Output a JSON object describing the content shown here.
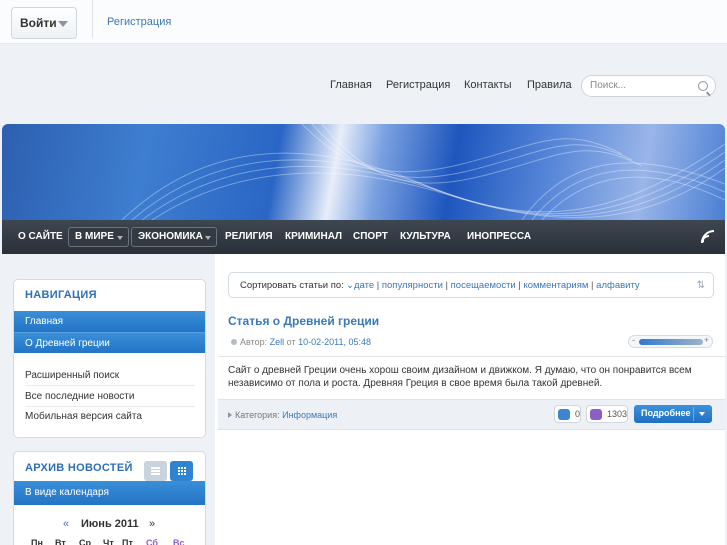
{
  "topbar": {
    "login_label": "Войти",
    "register_link": "Регистрация"
  },
  "header": {
    "menu": [
      "Главная",
      "Регистрация",
      "Контакты",
      "Правила"
    ],
    "search_placeholder": "Поиск..."
  },
  "mainnav": {
    "items": [
      "О САЙТЕ",
      "В МИРЕ",
      "ЭКОНОМИКА",
      "РЕЛИГИЯ",
      "КРИМИНАЛ",
      "СПОРТ",
      "КУЛЬТУРА",
      "ИНОПРЕССА"
    ]
  },
  "sidebar": {
    "nav_title": "НАВИГАЦИЯ",
    "nav_items": [
      "Главная",
      "О Древней греции"
    ],
    "nav_links": [
      "Расширенный поиск",
      "Все последние новости",
      "Мобильная версия сайта"
    ],
    "archive_title": "АРХИВ НОВОСТЕЙ",
    "archive_tab": "В виде календаря",
    "calendar": {
      "prev": "«",
      "month": "Июнь 2011",
      "next": "»",
      "days": [
        "Пн",
        "Вт",
        "Ср",
        "Чт",
        "Пт",
        "Сб",
        "Вс"
      ]
    }
  },
  "sort": {
    "label": "Сортировать статьи по:",
    "options": [
      "дате",
      "популярности",
      "посещаемости",
      "комментариям",
      "алфавиту"
    ]
  },
  "article": {
    "title": "Статья о Древней греции",
    "author_label": "Автор:",
    "author": "Zell",
    "date_prefix": "от",
    "date": "10-02-2011, 05:48",
    "text": "Сайт о древней Греции очень хорош своим дизайном и движком. Я думаю, что он понравится всем независимо от пола и роста. Древняя Греция в свое время была такой древней.",
    "category_label": "Категория:",
    "category": "Информация",
    "comments": "0",
    "views": "1303",
    "more_label": "Подробнее",
    "rating_fraction": 0.8
  },
  "colors": {
    "accent": "#2274c5",
    "nav_bg": "#2a3038",
    "link": "#3b78b8",
    "weekend": "#8a5fc8"
  }
}
